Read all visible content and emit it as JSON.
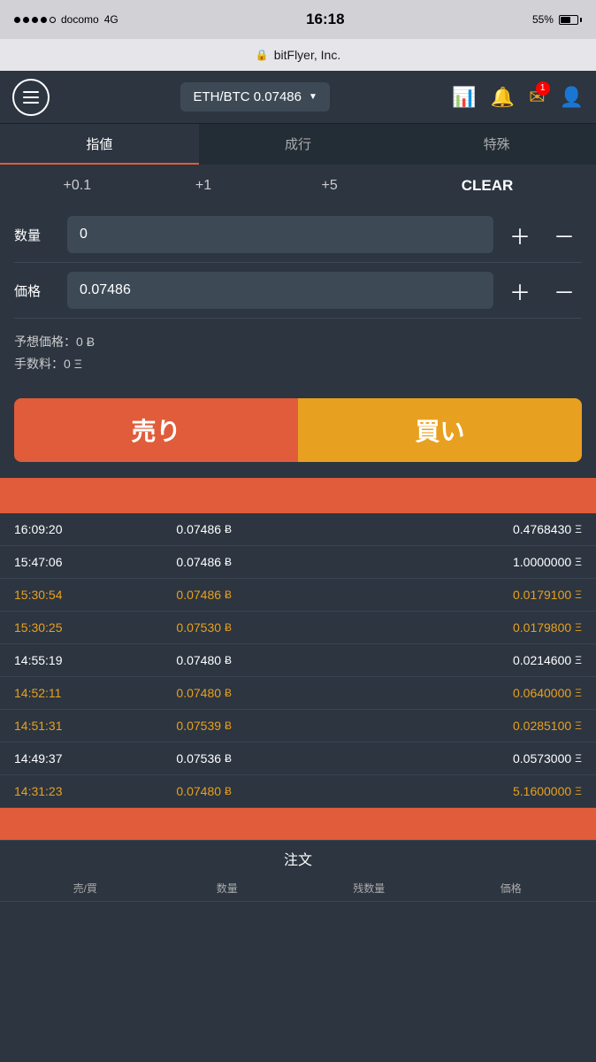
{
  "status_bar": {
    "carrier": "docomo",
    "network": "4G",
    "time": "16:18",
    "battery": "55%"
  },
  "url_bar": {
    "lock_text": "🔒",
    "url": "bitFlyer, Inc."
  },
  "header": {
    "currency_pair": "ETH/BTC 0.07486",
    "dropdown_arrow": "▼"
  },
  "tabs": [
    {
      "label": "指値",
      "active": true
    },
    {
      "label": "成行",
      "active": false
    },
    {
      "label": "特殊",
      "active": false
    }
  ],
  "qty_buttons": {
    "btn1": "+0.1",
    "btn2": "+1",
    "btn3": "+5",
    "clear": "CLEAR"
  },
  "form": {
    "quantity_label": "数量",
    "quantity_value": "0",
    "price_label": "価格",
    "price_value": "0.07486"
  },
  "info": {
    "expected_price_label": "予想価格：",
    "expected_price_value": "0",
    "expected_price_unit": "Ƀ",
    "fee_label": "手数料：",
    "fee_value": "0",
    "fee_unit": "Ξ"
  },
  "actions": {
    "sell_label": "売り",
    "buy_label": "買い"
  },
  "history": {
    "rows": [
      {
        "time": "16:09:20",
        "price": "0.07486",
        "amount": "0.4768430",
        "color": "white"
      },
      {
        "time": "15:47:06",
        "price": "0.07486",
        "amount": "1.0000000",
        "color": "white"
      },
      {
        "time": "15:30:54",
        "price": "0.07486",
        "amount": "0.0179100",
        "color": "orange"
      },
      {
        "time": "15:30:25",
        "price": "0.07530",
        "amount": "0.0179800",
        "color": "orange"
      },
      {
        "time": "14:55:19",
        "price": "0.07480",
        "amount": "0.0214600",
        "color": "white"
      },
      {
        "time": "14:52:11",
        "price": "0.07480",
        "amount": "0.0640000",
        "color": "orange"
      },
      {
        "time": "14:51:31",
        "price": "0.07539",
        "amount": "0.0285100",
        "color": "orange"
      },
      {
        "time": "14:49:37",
        "price": "0.07536",
        "amount": "0.0573000",
        "color": "white"
      },
      {
        "time": "14:31:23",
        "price": "0.07480",
        "amount": "5.1600000",
        "color": "orange"
      }
    ]
  },
  "bottom": {
    "order_label": "注文",
    "col_headers": [
      "売/買",
      "数量",
      "残数量",
      "価格"
    ]
  },
  "icons": {
    "menu": "☰",
    "chart": "📊",
    "bell": "🔔",
    "mail": "✉",
    "user": "👤",
    "btc": "Ƀ",
    "eth": "Ξ"
  }
}
